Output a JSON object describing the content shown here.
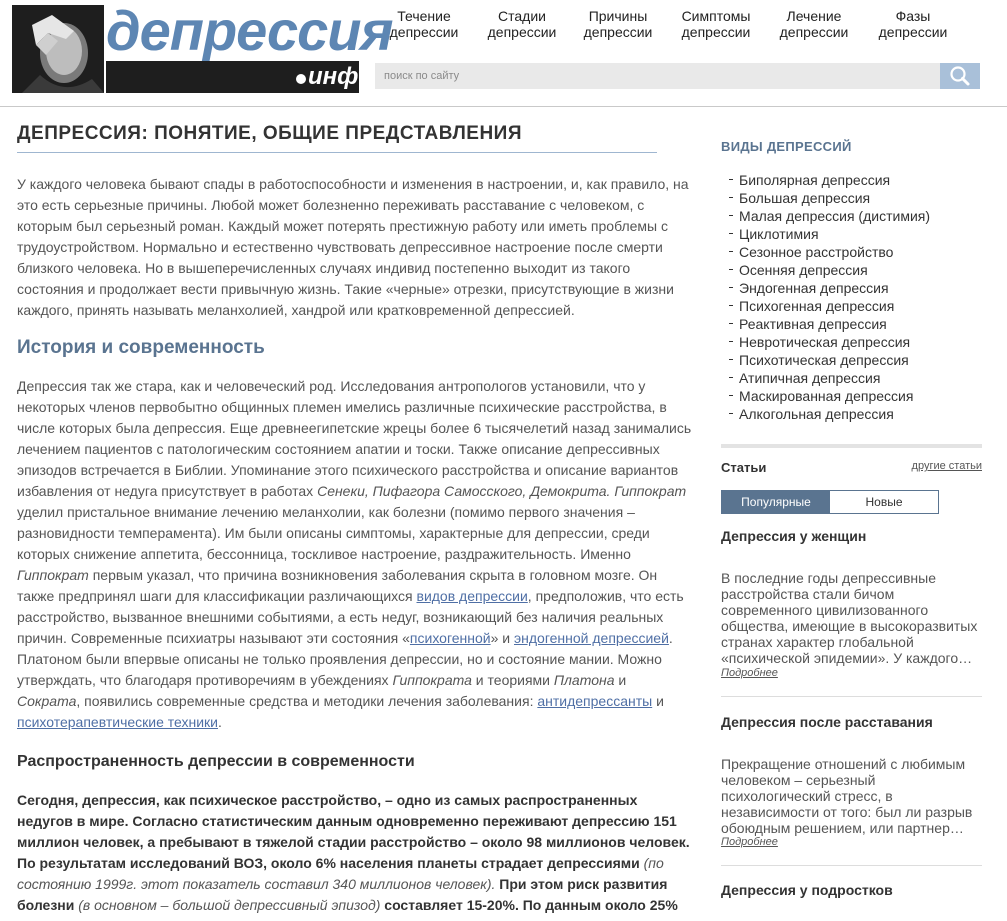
{
  "logo": {
    "word": "депрессия",
    "suffix": "инфо"
  },
  "nav": [
    {
      "label": "Течение депрессии"
    },
    {
      "label": "Стадии депрессии"
    },
    {
      "label": "Причины депрессии"
    },
    {
      "label": "Симптомы депрессии"
    },
    {
      "label": "Лечение депрессии"
    },
    {
      "label": "Фазы депрессии"
    }
  ],
  "search": {
    "placeholder": "поиск по сайту"
  },
  "main": {
    "title": "ДЕПРЕССИЯ: ПОНЯТИЕ, ОБЩИЕ ПРЕДСТАВЛЕНИЯ",
    "intro": "У каждого человека бывают спады в работоспособности и изменения в настроении, и, как правило, на это есть серьезные причины. Любой может болезненно переживать расставание с человеком, с которым был серьезный роман. Каждый может потерять престижную работу или иметь проблемы с трудоустройством. Нормально и естественно чувствовать депрессивное настроение после смерти близкого человека. Но в вышеперечисленных случаях индивид постепенно выходит из такого состояния и продолжает вести привычную жизнь. Такие «черные» отрезки, присутствующие в жизни каждого, принять называть меланхолией, хандрой или кратковременной депрессией.",
    "history_title": "История и современность",
    "history": {
      "t1": "Депрессия так же стара, как и человеческий род. Исследования антропологов установили, что у некоторых членов первобытно общинных племен имелись различные психические расстройства, в числе которых была депрессия. Еще древнеегипетские жрецы более 6 тысячелетий назад занимались лечением пациентов с патологическим состоянием апатии и тоски. Также описание депрессивных эпизодов встречается в Библии. Упоминание этого психического расстройства и описание вариантов избавления от недуга присутствует в работах ",
      "i1": "Сенеки, Пифагора Самосского, Демокрита. Гиппократ",
      "t2": " уделил пристальное внимание лечению меланхолии, как болезни (помимо первого значения – разновидности темперамента). Им были описаны симптомы, характерные для депрессии, среди которых снижение аппетита, бессонница, тоскливое настроение, раздражительность. Именно ",
      "i2": "Гиппократ",
      "t3": " первым указал, что причина возникновения заболевания скрыта в головном мозге. Он также предпринял шаги для классификации различающихся ",
      "l1": "видов депрессии",
      "t4": ", предположив, что есть расстройство, вызванное внешними событиями, а есть недуг, возникающий без наличия реальных причин. Современные психиатры называют эти состояния «",
      "l2": "психогенной",
      "t5": "» и ",
      "l3": "эндогенной депрессией",
      "t6": ". Платоном были впервые описаны не только проявления депрессии, но и состояние мании. Можно утверждать, что благодаря противоречиям в убеждениях ",
      "i3": "Гиппократа",
      "t7": " и теориями ",
      "i4": "Платона",
      "t8": " и ",
      "i5": "Сократа",
      "t9": ", появились современные средства и методики лечения заболевания: ",
      "l4": "антидепрессанты",
      "t10": " и ",
      "l5": "психотерапевтические техники",
      "t11": "."
    },
    "prevalence_title": "Распространенность депрессии в современности",
    "prevalence": {
      "b1": "Сегодня, депрессия, как психическое расстройство, – одно из самых распространенных недугов в мире. Согласно статистическим данным одновременно переживают депрессию 151 миллион человек, а пребывают в тяжелой стадии расстройство – около 98 миллионов человек. По результатам исследований ВОЗ, около 6% населения планеты страдает депрессиями",
      "i1": " (по состоянию 1999г. этот показатель составил 340 миллионов человек).",
      "b2": " При этом риск развития болезни",
      "i2": " (в основном – большой депрессивный эпизод)",
      "b3": " составляет 15-20%. По данным около 25%"
    }
  },
  "sidebar": {
    "title": "ВИДЫ ДЕПРЕССИЙ",
    "types": [
      "Биполярная депрессия",
      "Большая депрессия",
      "Малая депрессия (дистимия)",
      "Циклотимия",
      "Сезонное расстройство",
      "Осенняя депрессия",
      "Эндогенная депрессия",
      "Психогенная депрессия",
      "Реактивная депрессия",
      "Невротическая депрессия",
      "Психотическая депрессия",
      "Атипичная депрессия",
      "Маскированная депрессия",
      "Алкогольная депрессия"
    ],
    "articles_title": "Статьи",
    "other_link": "другие статьи",
    "tabs": {
      "popular": "Популярные",
      "new": "Новые"
    },
    "articles": [
      {
        "title": "Депрессия у женщин",
        "text": "В последние годы депрессивные расстройства стали бичом современного цивилизованного общества, имеющие в высокоразвитых странах характер глобальной «психической эпидемии». У каждого…",
        "more": "Подробнее"
      },
      {
        "title": "Депрессия после расставания",
        "text": "Прекращение отношений с любимым человеком – серьезный психологический стресс, в независимости от того: был ли разрыв обоюдным решением, или партнер…",
        "more": "Подробнее"
      },
      {
        "title": "Депрессия у подростков"
      }
    ]
  }
}
